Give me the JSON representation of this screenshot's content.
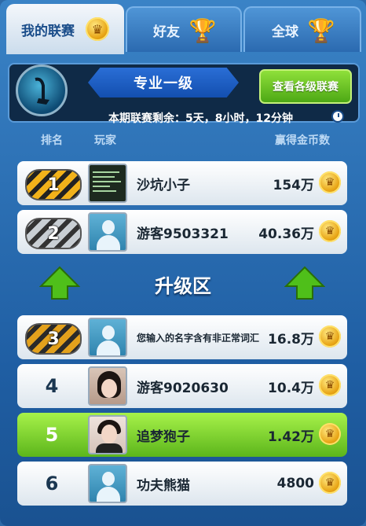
{
  "tabs": [
    {
      "label": "我的联赛",
      "icon": "crown-icon",
      "active": true
    },
    {
      "label": "好友",
      "icon": "trophy-icon",
      "active": false
    },
    {
      "label": "全球",
      "icon": "trophy-icon",
      "active": false
    }
  ],
  "header": {
    "league_name": "专业一级",
    "view_levels_label": "查看各级联赛",
    "remaining_label": "本期联赛剩余：5天，8小时，12分钟",
    "emblem_icon": "golf-club-emblem-icon"
  },
  "columns": {
    "rank": "排名",
    "player": "玩家",
    "coins": "赢得金币数"
  },
  "promo_zone_label": "升级区",
  "rows": [
    {
      "rank": "1",
      "name": "沙坑小子",
      "coins": "154万",
      "badge": "gold",
      "avatar": "terminal-avatar",
      "highlight": false
    },
    {
      "rank": "2",
      "name": "游客9503321",
      "coins": "40.36万",
      "badge": "silver",
      "avatar": "default-avatar",
      "highlight": false
    },
    {
      "rank": "3",
      "name": "您输入的名字含有非正常词汇",
      "coins": "16.8万",
      "badge": "bronze",
      "avatar": "default-avatar",
      "highlight": false
    },
    {
      "rank": "4",
      "name": "游客9020630",
      "coins": "10.4万",
      "badge": "",
      "avatar": "girl-photo-avatar",
      "highlight": false
    },
    {
      "rank": "5",
      "name": "追梦狍子",
      "coins": "1.42万",
      "badge": "",
      "avatar": "boy-photo-avatar",
      "highlight": true
    },
    {
      "rank": "6",
      "name": "功夫熊猫",
      "coins": "4800",
      "badge": "",
      "avatar": "default-avatar",
      "highlight": false
    }
  ],
  "colors": {
    "accent_green": "#6cc524",
    "panel_blue": "#1f5ea3",
    "gold": "#e8a516"
  }
}
